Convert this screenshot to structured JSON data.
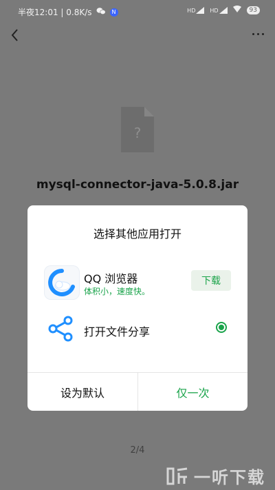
{
  "status_bar": {
    "time_speed": "半夜12:01 | 0.8K/s",
    "badge_letter": "N",
    "signal1_label": "HD",
    "signal2_label": "HD",
    "battery": "93"
  },
  "file": {
    "icon_glyph": "?",
    "name": "mysql-connector-java-5.0.8.jar"
  },
  "dialog": {
    "title": "选择其他应用打开",
    "app": {
      "name": "QQ 浏览器",
      "description": "体积小，速度快。",
      "download_label": "下载"
    },
    "share": {
      "label": "打开文件分享",
      "selected": true
    },
    "buttons": {
      "set_default": "设为默认",
      "once": "仅一次"
    }
  },
  "page_indicator": "2/4",
  "watermark": {
    "text": "一听下载"
  },
  "colors": {
    "accent_green": "#19a34a",
    "overlay_gray": "#7a7a7a",
    "status_badge_blue": "#3a64ff"
  }
}
